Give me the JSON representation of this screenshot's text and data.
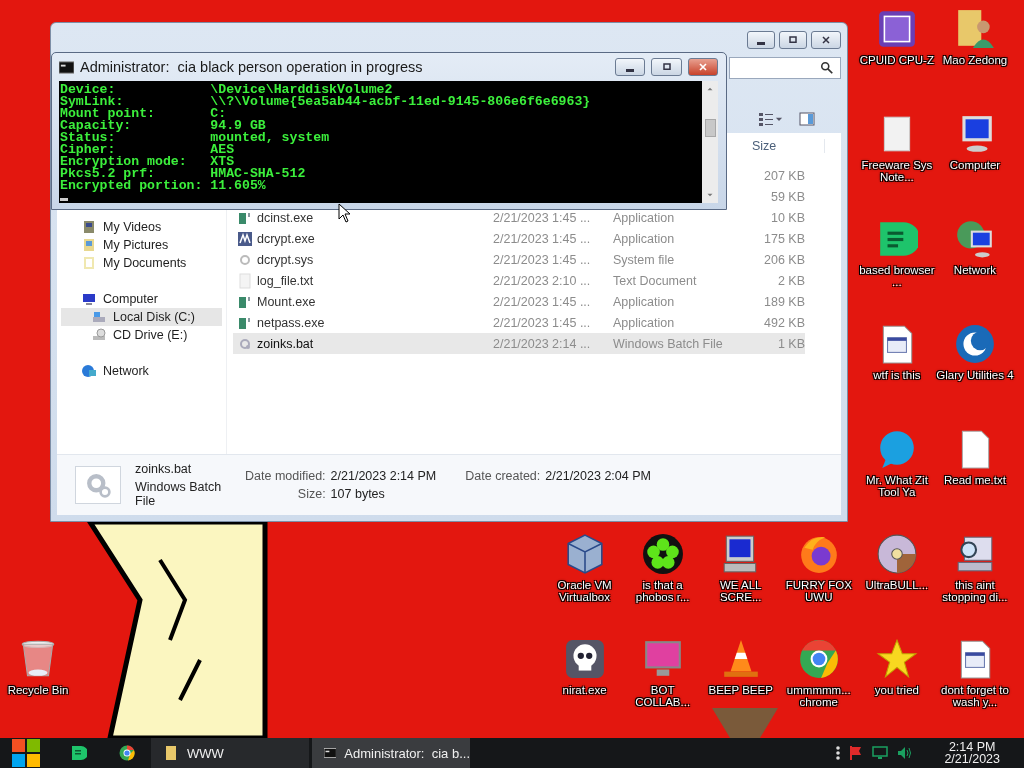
{
  "console": {
    "title": "Administrator:  cia black person operation in progress",
    "lines": [
      {
        "label": "Device:",
        "value": "\\Device\\HarddiskVolume2"
      },
      {
        "label": "SymLink:",
        "value": "\\\\?\\Volume{5ea5ab44-acbf-11ed-9145-806e6f6e6963}"
      },
      {
        "label": "Mount point:",
        "value": "C:"
      },
      {
        "label": "Capacity:",
        "value": "94.9 GB"
      },
      {
        "label": "Status:",
        "value": "mounted, system"
      },
      {
        "label": "Cipher:",
        "value": "AES"
      },
      {
        "label": "Encryption mode:",
        "value": "XTS"
      },
      {
        "label": "Pkcs5.2 prf:",
        "value": "HMAC-SHA-512"
      },
      {
        "label": "Encrypted portion:",
        "value": "11.605%"
      }
    ]
  },
  "explorer": {
    "size_header": "Size",
    "nav_sections": [
      {
        "items": [
          {
            "label": "My Videos",
            "kind": "video",
            "selected": false
          },
          {
            "label": "My Pictures",
            "kind": "pictures",
            "selected": false
          },
          {
            "label": "My Documents",
            "kind": "documents",
            "selected": false
          }
        ]
      },
      {
        "items": [
          {
            "label": "Computer",
            "kind": "computer",
            "selected": false,
            "children": [
              {
                "label": "Local Disk (C:)",
                "kind": "drive",
                "selected": true
              },
              {
                "label": "CD Drive (E:)",
                "kind": "cd",
                "selected": false
              }
            ]
          }
        ]
      },
      {
        "items": [
          {
            "label": "Network",
            "kind": "network",
            "selected": false
          }
        ]
      }
    ],
    "files": [
      {
        "size": "207 KB",
        "selected": false
      },
      {
        "size": "59 KB",
        "selected": false
      },
      {
        "name": "dcinst.exe",
        "date": "2/21/2023 1:45 ...",
        "type": "Application",
        "size": "10 KB",
        "kind": "app",
        "selected": false
      },
      {
        "name": "dcrypt.exe",
        "date": "2/21/2023 1:45 ...",
        "type": "Application",
        "size": "175 KB",
        "kind": "dcrypt",
        "selected": false
      },
      {
        "name": "dcrypt.sys",
        "date": "2/21/2023 1:45 ...",
        "type": "System file",
        "size": "206 KB",
        "kind": "system",
        "selected": false
      },
      {
        "name": "log_file.txt",
        "date": "2/21/2023 2:10 ...",
        "type": "Text Document",
        "size": "2 KB",
        "kind": "text",
        "selected": false
      },
      {
        "name": "Mount.exe",
        "date": "2/21/2023 1:45 ...",
        "type": "Application",
        "size": "189 KB",
        "kind": "app",
        "selected": false
      },
      {
        "name": "netpass.exe",
        "date": "2/21/2023 1:45 ...",
        "type": "Application",
        "size": "492 KB",
        "kind": "app",
        "selected": false
      },
      {
        "name": "zoinks.bat",
        "date": "2/21/2023 2:14 ...",
        "type": "Windows Batch File",
        "size": "1 KB",
        "kind": "batch",
        "selected": true
      }
    ],
    "details": {
      "name": "zoinks.bat",
      "type": "Windows Batch File",
      "fields": [
        {
          "label": "Date modified:",
          "value": "2/21/2023 2:14 PM"
        },
        {
          "label": "Date created:",
          "value": "2/21/2023 2:04 PM"
        },
        {
          "label": "Size:",
          "value": "107 bytes"
        }
      ]
    }
  },
  "desktop_icons": [
    {
      "label": "CPUID CPU-Z",
      "kind": "chip"
    },
    {
      "label": "Mao Zedong",
      "kind": "user_folder"
    },
    {
      "label": "Freeware Sys Note...",
      "kind": "blank"
    },
    {
      "label": "Computer",
      "kind": "computer"
    },
    {
      "label": "based browser ...",
      "kind": "chat"
    },
    {
      "label": "Network",
      "kind": "network"
    },
    {
      "label": "wtf is this",
      "kind": "window_doc"
    },
    {
      "label": "Glary Utilities 4",
      "kind": "crescent"
    },
    {
      "label": "Mr. What Zit Tool Ya",
      "kind": "bubble"
    },
    {
      "label": "Read me.txt",
      "kind": "text_doc"
    },
    {
      "label": "Oracle VM Virtualbox",
      "kind": "cube"
    },
    {
      "label": "is that a phobos r...",
      "kind": "flower"
    },
    {
      "label": "WE ALL SCRE...",
      "kind": "terminal"
    },
    {
      "label": "FURRY FOX UWU",
      "kind": "flame"
    },
    {
      "label": "UltraBULL...",
      "kind": "disc"
    },
    {
      "label": "this aint stopping di...",
      "kind": "search_pc"
    },
    {
      "label": "Recycle Bin",
      "kind": "bin"
    },
    {
      "label": "nirat.exe",
      "kind": "skull"
    },
    {
      "label": "BOT COLLAB...",
      "kind": "monitor"
    },
    {
      "label": "BEEP BEEP",
      "kind": "cone"
    },
    {
      "label": "ummmmm... chrome",
      "kind": "chrome"
    },
    {
      "label": "you tried",
      "kind": "star"
    },
    {
      "label": "dont forget to wash y...",
      "kind": "window_doc"
    }
  ],
  "taskbar": {
    "windows": [
      {
        "label": "WWW",
        "kind": "folder",
        "selected": false
      },
      {
        "label": "Administrator:  cia b...",
        "kind": "console",
        "selected": true
      }
    ],
    "clock": {
      "time": "2:14 PM",
      "date": "2/21/2023"
    }
  }
}
